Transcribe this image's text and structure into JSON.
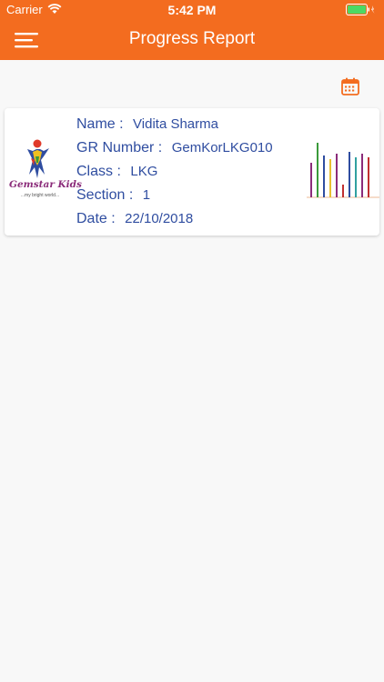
{
  "status_bar": {
    "carrier": "Carrier",
    "time": "5:42 PM"
  },
  "nav": {
    "title": "Progress Report",
    "menu_icon": "hamburger-menu-icon",
    "calendar_icon": "calendar-icon"
  },
  "colors": {
    "accent": "#f36c1f",
    "text_blue": "#2f4da0"
  },
  "report_card": {
    "logo": {
      "brand": "Gemstar Kids",
      "tagline": "...my bright world..."
    },
    "fields": [
      {
        "label": "Name :",
        "value": "Vidita Sharma"
      },
      {
        "label": "GR Number :",
        "value": "GemKorLKG010"
      },
      {
        "label": "Class :",
        "value": "LKG"
      },
      {
        "label": "Section :",
        "value": "1"
      },
      {
        "label": "Date :",
        "value": "22/10/2018"
      }
    ],
    "thumbnail_chart_colors": [
      "#8b2c7a",
      "#3a9a3a",
      "#2f4da0",
      "#e8c030",
      "#8b2c7a",
      "#c03030",
      "#2f4da0",
      "#30a0a0",
      "#8b2c7a",
      "#c03030"
    ]
  }
}
